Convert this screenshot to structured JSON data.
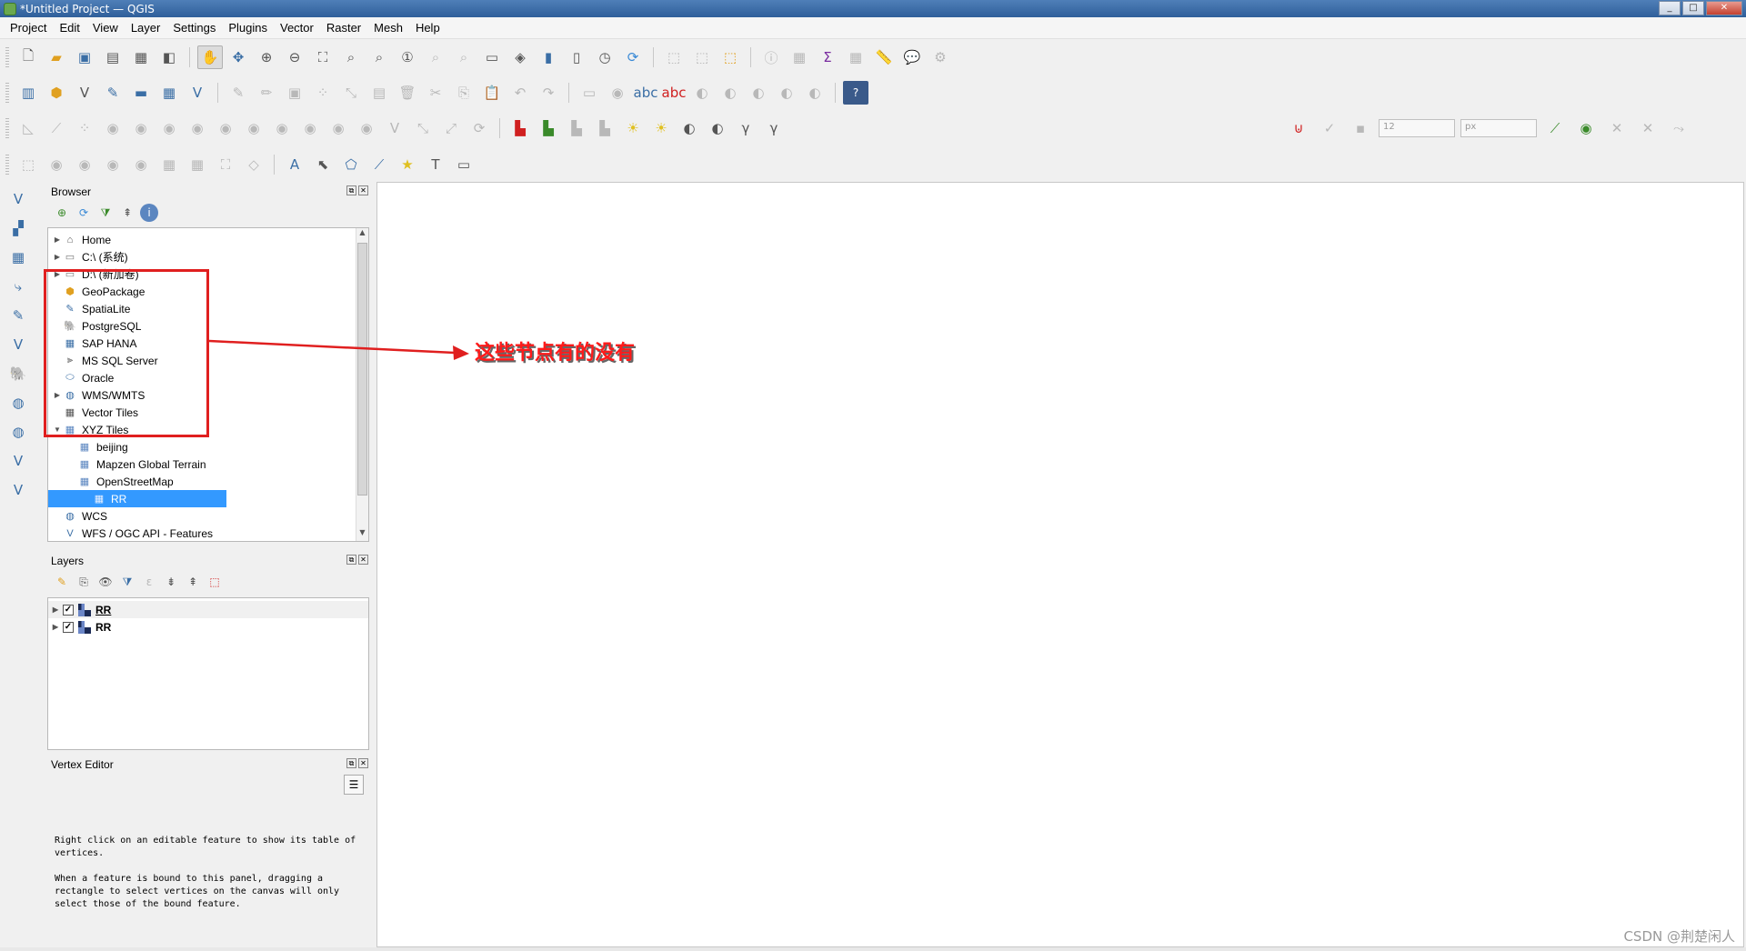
{
  "window": {
    "title": "*Untitled Project — QGIS",
    "minimize": "_",
    "maximize": "□",
    "close": "✕"
  },
  "menubar": [
    "Project",
    "Edit",
    "View",
    "Layer",
    "Settings",
    "Plugins",
    "Vector",
    "Raster",
    "Mesh",
    "Help"
  ],
  "snapping": {
    "tolerance": "12",
    "units": "px"
  },
  "browser": {
    "title": "Browser",
    "items": [
      {
        "label": "Home",
        "icon": "home-icon",
        "expandable": true,
        "indent": 0
      },
      {
        "label": "C:\\ (系统)",
        "icon": "drive-icon",
        "expandable": true,
        "indent": 0
      },
      {
        "label": "D:\\ (新加卷)",
        "icon": "drive-icon",
        "expandable": true,
        "indent": 0
      },
      {
        "label": "GeoPackage",
        "icon": "geopackage-icon",
        "expandable": false,
        "indent": 0
      },
      {
        "label": "SpatiaLite",
        "icon": "spatialite-icon",
        "expandable": false,
        "indent": 0
      },
      {
        "label": "PostgreSQL",
        "icon": "postgresql-icon",
        "expandable": false,
        "indent": 0
      },
      {
        "label": "SAP HANA",
        "icon": "sap-hana-icon",
        "expandable": false,
        "indent": 0
      },
      {
        "label": "MS SQL Server",
        "icon": "mssql-icon",
        "expandable": false,
        "indent": 0
      },
      {
        "label": "Oracle",
        "icon": "oracle-icon",
        "expandable": false,
        "indent": 0
      },
      {
        "label": "WMS/WMTS",
        "icon": "wms-icon",
        "expandable": true,
        "indent": 0
      },
      {
        "label": "Vector Tiles",
        "icon": "vector-tiles-icon",
        "expandable": false,
        "indent": 0
      },
      {
        "label": "XYZ Tiles",
        "icon": "xyz-tiles-icon",
        "expandable": true,
        "expanded": true,
        "indent": 0
      },
      {
        "label": "beijing",
        "icon": "xyz-tiles-icon",
        "expandable": false,
        "indent": 1
      },
      {
        "label": "Mapzen Global Terrain",
        "icon": "xyz-tiles-icon",
        "expandable": false,
        "indent": 1
      },
      {
        "label": "OpenStreetMap",
        "icon": "xyz-tiles-icon",
        "expandable": false,
        "indent": 1
      },
      {
        "label": "RR",
        "icon": "xyz-tiles-icon",
        "expandable": false,
        "indent": 1,
        "selected": true
      },
      {
        "label": "WCS",
        "icon": "wcs-icon",
        "expandable": false,
        "indent": 0
      },
      {
        "label": "WFS / OGC API - Features",
        "icon": "wfs-icon",
        "expandable": false,
        "indent": 0
      }
    ]
  },
  "layers": {
    "title": "Layers",
    "items": [
      {
        "label": "RR",
        "checked": true,
        "underlined": true
      },
      {
        "label": "RR",
        "checked": true,
        "underlined": false
      }
    ]
  },
  "vertex_editor": {
    "title": "Vertex Editor",
    "text1": "Right click on an editable feature to show its table of vertices.",
    "text2": "When a feature is bound to this panel, dragging a rectangle to select vertices on the canvas will only select those of the bound feature."
  },
  "annotation": {
    "label": "这些节点有的没有",
    "color": "#e01f1f"
  },
  "watermark": "CSDN @荆楚闲人"
}
